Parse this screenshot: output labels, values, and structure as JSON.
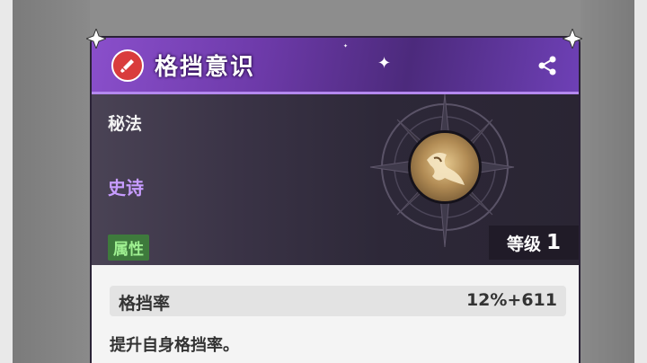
{
  "card": {
    "title": "格挡意识",
    "category": "秘法",
    "rarity": "史诗",
    "attribute_tag": "属性",
    "level_label": "等级",
    "level_value": "1"
  },
  "stat": {
    "name": "格挡率",
    "value": "12%+611"
  },
  "description": "提升自身格挡率。",
  "colors": {
    "header_purple": "#6d3aa9",
    "rarity_purple": "#c79cff",
    "attribute_green": "#3e7a3c",
    "emblem_red": "#d93c3c"
  },
  "icons": [
    "sword-emblem-icon",
    "share-icon",
    "relic-orb-icon",
    "corner-ornament-icon"
  ]
}
